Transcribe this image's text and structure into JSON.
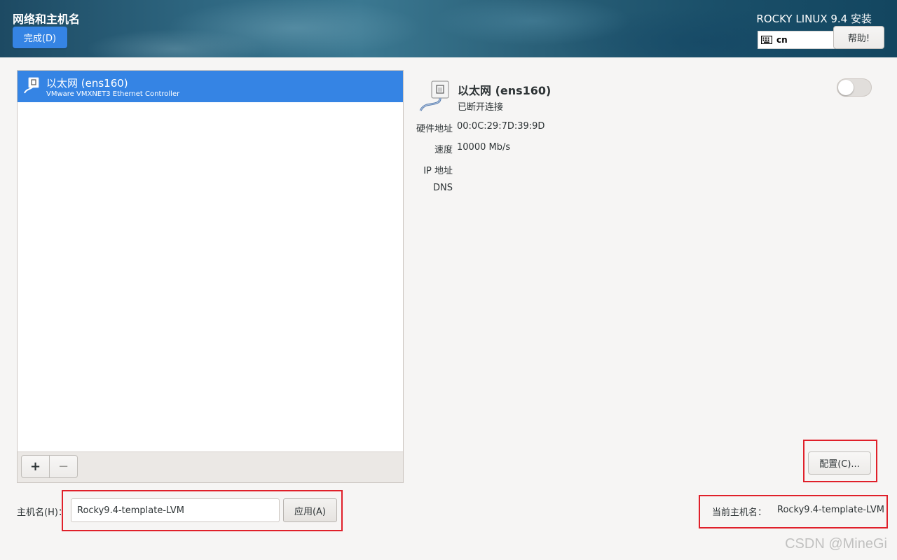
{
  "header": {
    "page_title": "网络和主机名",
    "done_label": "完成(D)",
    "install_title": "ROCKY LINUX 9.4 安装",
    "keyboard_layout": "cn",
    "help_label": "帮助!"
  },
  "device_list": {
    "items": [
      {
        "name": "以太网 (ens160)",
        "subtitle": "VMware VMXNET3 Ethernet Controller",
        "selected": true,
        "icon": "ethernet-icon"
      }
    ],
    "add_label": "+",
    "remove_label": "−"
  },
  "details": {
    "name": "以太网 (ens160)",
    "status": "已断开连接",
    "toggle_on": false,
    "fields": [
      {
        "label": "硬件地址",
        "value": "00:0C:29:7D:39:9D"
      },
      {
        "label": "速度",
        "value": "10000 Mb/s"
      },
      {
        "label": "IP 地址",
        "value": ""
      },
      {
        "label": "DNS",
        "value": ""
      }
    ],
    "configure_label": "配置(C)..."
  },
  "hostname": {
    "label": "主机名(H)：",
    "value": "Rocky9.4-template-LVM",
    "apply_label": "应用(A)",
    "current_label": "当前主机名：",
    "current_value": "Rocky9.4-template-LVM"
  },
  "watermark": "CSDN @MineGi",
  "colors": {
    "accent": "#3584e4",
    "annotation": "#e0202a"
  }
}
